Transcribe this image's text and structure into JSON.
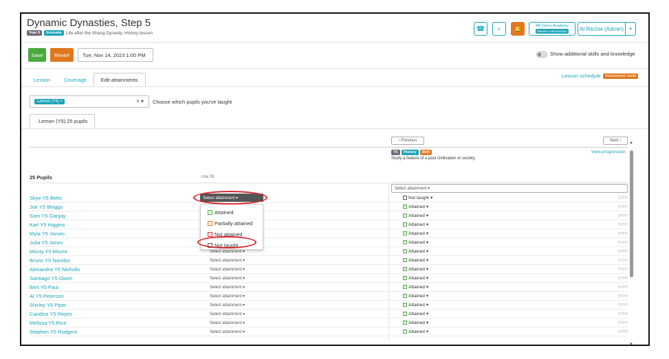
{
  "header": {
    "title": "Dynamic Dynasties, Step 5",
    "year_tag": "Year 5",
    "innovate_tag": "Innovate",
    "subtitle_main": "Life after the Shang Dynasty",
    "subtitle_sep": ",",
    "subtitle_lesson": "History lesson",
    "phone_icon": "☎",
    "search_icon": "⌕",
    "bell_icon": "🔔",
    "school_name": "AR Demo Academy",
    "school_role": "Maestro Administrator",
    "user_name": "Al Ritchie (Admin)",
    "user_dropdown": "▾"
  },
  "toolbar": {
    "save_label": "Save",
    "revert_label": "Revert",
    "date_value": "Tue, Nov 14, 2023 1:00 PM",
    "toggle_label": "Show additional skills and knowledge"
  },
  "tabs": [
    {
      "label": "Lesson"
    },
    {
      "label": "Coverage"
    },
    {
      "label": "Edit attainments"
    }
  ],
  "lesson_schedule": {
    "label": "Lesson schedule",
    "badge": "Assessment mode"
  },
  "pupil_filter": {
    "chip": ".Lemon (Y5) ×",
    "clear": "× ▾",
    "label": "Choose which pupils you've taught"
  },
  "class_tab": ".Lemon (Y5) 25 pupils",
  "nav": {
    "previous": "‹  Previous",
    "next": "Next  ›",
    "view_progression": "View progression"
  },
  "objective": {
    "tags": [
      "Y5",
      "History",
      "Skill"
    ],
    "text": "Study a feature of a past civilisation or society."
  },
  "table": {
    "pupils_header": "25 Pupils",
    "rowfill_label": "row fill",
    "fill_select": "Select attainment ▾",
    "select_default": "Select attainment ▾",
    "circles": "○○○"
  },
  "rows": [
    {
      "name": "Skye Y5 Betts",
      "attainment": "Not taught",
      "icon": "none"
    },
    {
      "name": "Joe Y5 Bloggs",
      "attainment": "Attained",
      "icon": "check"
    },
    {
      "name": "Sam Y5 Ganjay",
      "attainment": "Attained",
      "icon": "check"
    },
    {
      "name": "Karl Y5 Higgins",
      "attainment": "Attained",
      "icon": "check"
    },
    {
      "name": "Myla Y5 James",
      "attainment": "Attained",
      "icon": "check"
    },
    {
      "name": "Julia Y5 Jones",
      "attainment": "Attained",
      "icon": "check"
    },
    {
      "name": "Monty Y5 Moore",
      "attainment": "Attained",
      "icon": "check"
    },
    {
      "name": "Bruno Y5 Nandos",
      "attainment": "Attained",
      "icon": "check"
    },
    {
      "name": "Alexandra Y5 Nicholls",
      "attainment": "Attained",
      "icon": "check"
    },
    {
      "name": "Santiago Y5 Owen",
      "attainment": "Attained",
      "icon": "check"
    },
    {
      "name": "Bert Y5 Paul",
      "attainment": "Attained",
      "icon": "check"
    },
    {
      "name": "Al Y5 Peterson",
      "attainment": "Attained",
      "icon": "check"
    },
    {
      "name": "Shirley Y5 Piper",
      "attainment": "Attained",
      "icon": "check"
    },
    {
      "name": "Candice Y5 Reyes",
      "attainment": "Attained",
      "icon": "check"
    },
    {
      "name": "Melissa Y5 Rice",
      "attainment": "Attained",
      "icon": "check"
    },
    {
      "name": "Stephen Y5 Rodgers",
      "attainment": "Attained",
      "icon": "check"
    }
  ],
  "dropdown": {
    "items": [
      {
        "label": "Attained",
        "mark": "✓"
      },
      {
        "label": "Partially attained",
        "mark": "✓"
      },
      {
        "label": "Not attained",
        "mark": "×"
      },
      {
        "label": "Not taught",
        "mark": ""
      }
    ]
  },
  "colors": {
    "teal": "#1aa3b8",
    "green": "#4aaa3e",
    "orange": "#e0781f",
    "red": "#d8262c"
  }
}
